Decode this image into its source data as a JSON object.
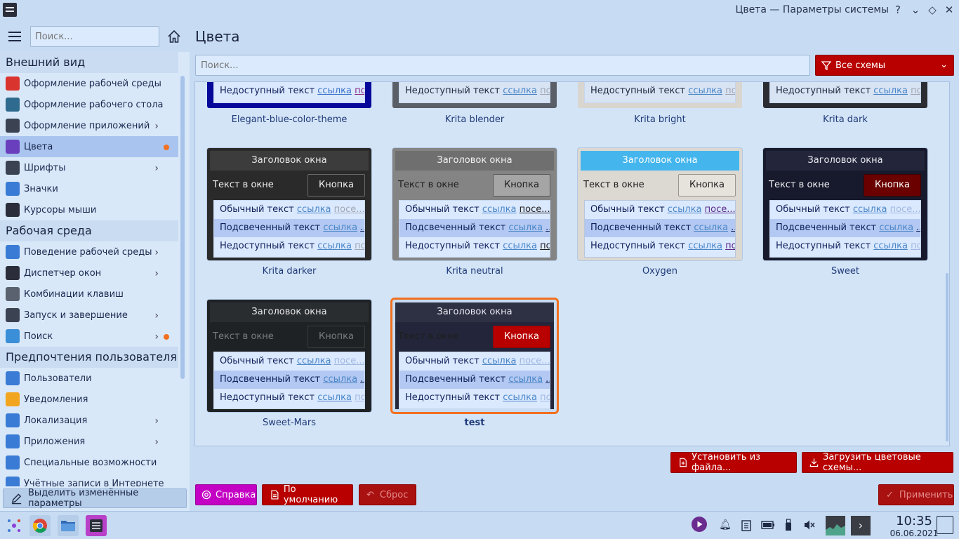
{
  "window": {
    "title": "Цвета — Параметры системы",
    "help_glyph": "?",
    "min_glyph": "⌄",
    "max_glyph": "◇",
    "close_glyph": "✕"
  },
  "sidebar": {
    "search_placeholder": "Поиск...",
    "sections": [
      {
        "title": "Внешний вид",
        "items": [
          {
            "label": "Оформление рабочей среды",
            "icon": "workspace-theme-icon",
            "color": "#d9352e"
          },
          {
            "label": "Оформление рабочего стола",
            "icon": "plasma-theme-icon",
            "color": "#2f6a8f"
          },
          {
            "label": "Оформление приложений",
            "icon": "app-style-icon",
            "color": "#3b4252",
            "chevron": true
          },
          {
            "label": "Цвета",
            "icon": "colors-icon",
            "color": "#6a3fbd",
            "active": true,
            "dot": true
          },
          {
            "label": "Шрифты",
            "icon": "fonts-icon",
            "color": "#3b4252",
            "chevron": true
          },
          {
            "label": "Значки",
            "icon": "icons-icon",
            "color": "#3a7bd5"
          },
          {
            "label": "Курсоры мыши",
            "icon": "cursor-icon",
            "color": "#2b2e3a"
          }
        ]
      },
      {
        "title": "Рабочая среда",
        "items": [
          {
            "label": "Поведение рабочей среды",
            "icon": "desktop-behavior-icon",
            "color": "#3a7bd5",
            "chevron": true
          },
          {
            "label": "Диспетчер окон",
            "icon": "window-manager-icon",
            "color": "#2b2e3a",
            "chevron": true
          },
          {
            "label": "Комбинации клавиш",
            "icon": "keyboard-icon",
            "color": "#5a6270"
          },
          {
            "label": "Запуск и завершение",
            "icon": "startup-icon",
            "color": "#3b4252",
            "chevron": true
          },
          {
            "label": "Поиск",
            "icon": "search-icon",
            "color": "#3a8fd8",
            "chevron": true,
            "dot": true
          }
        ]
      },
      {
        "title": "Предпочтения пользователя",
        "items": [
          {
            "label": "Пользователи",
            "icon": "users-icon",
            "color": "#3a7bd5"
          },
          {
            "label": "Уведомления",
            "icon": "bell-icon",
            "color": "#f2a61f"
          },
          {
            "label": "Локализация",
            "icon": "locale-icon",
            "color": "#3a7bd5",
            "chevron": true
          },
          {
            "label": "Приложения",
            "icon": "apps-icon",
            "color": "#3a7bd5",
            "chevron": true
          },
          {
            "label": "Специальные возможности",
            "icon": "accessibility-icon",
            "color": "#3a7bd5"
          },
          {
            "label": "Учётные записи в Интернете",
            "icon": "online-accounts-icon",
            "color": "#3a7bd5"
          }
        ]
      }
    ],
    "highlight_button": "Выделить изменённые параметры"
  },
  "main": {
    "title": "Цвета",
    "search_placeholder": "Поиск...",
    "filter_label": "Все схемы",
    "preview_strings": {
      "window_title": "Заголовок окна",
      "window_text": "Текст в окне",
      "button": "Кнопка",
      "normal": "Обычный текст",
      "selected": "Подсвеченный текст",
      "disabled": "Недоступный текст",
      "link": "ссылка",
      "visited_normal": "посе...",
      "visited_short": "по...",
      "visited_dots": "..."
    },
    "top_row": [
      {
        "name": "Elegant-blue-color-theme",
        "frame": "#06089a",
        "view_bg": "#dbe9ff",
        "text": "#10205a",
        "link": "#3b72c8",
        "visited": "#8a2b8a",
        "visited_text": "по"
      },
      {
        "name": "Krita blender",
        "frame": "#5a5e66",
        "view_bg": "#d8e4f4",
        "text": "#202a40",
        "link": "#4a86c8",
        "visited": "#a0a6b3",
        "visited_text": "по..."
      },
      {
        "name": "Krita bright",
        "frame": "#d9d5cf",
        "view_bg": "#d8e4f4",
        "text": "#202a40",
        "link": "#4a86c8",
        "visited": "#a0a6b3",
        "visited_text": "по..."
      },
      {
        "name": "Krita dark",
        "frame": "#2b2d33",
        "view_bg": "#d8e4f4",
        "text": "#202a40",
        "link": "#4a86c8",
        "visited": "#a0a6b3",
        "visited_text": "по..."
      }
    ],
    "themes": [
      {
        "name": "Krita darker",
        "frame": "#2a2a2a",
        "title_bg": "#3c3c3c",
        "title_fg": "#e8e8e8",
        "win_text": "#f0f0f0",
        "btn_bg": "#2a2a2a",
        "btn_fg": "#f0f0f0",
        "btn_border": "#6a6a6a",
        "view_bg": "#dbe9ff",
        "view_border": "#c6d6ee",
        "sel_bg": "#b3c8f2",
        "text": "#10205a",
        "link": "#4a86c8",
        "visited": "#a0a6b3",
        "row3_visited": "по...",
        "row1_visited": "посе...",
        "selected": false
      },
      {
        "name": "Krita neutral",
        "frame": "#848484",
        "title_bg": "#6f6f6f",
        "title_fg": "#f2f2f2",
        "win_text": "#202020",
        "btn_bg": "#a5a5a5",
        "btn_fg": "#202020",
        "btn_border": "#5a5a5a",
        "view_bg": "#dbe9ff",
        "view_border": "#c6d6ee",
        "sel_bg": "#b3c8f2",
        "text": "#10205a",
        "link": "#4a86c8",
        "visited": "#202020",
        "row3_visited": "по...",
        "row1_visited": "посе...",
        "selected": false
      },
      {
        "name": "Oxygen",
        "frame": "#dcd8d2",
        "title_bg": "#45b6ed",
        "title_fg": "#ffffff",
        "win_text": "#202020",
        "btn_bg": "#e6e2dc",
        "btn_fg": "#202020",
        "btn_border": "#9a958e",
        "view_bg": "#dbe9ff",
        "view_border": "#b7c6dc",
        "sel_bg": "#b3c8f2",
        "text": "#10205a",
        "link": "#4a86c8",
        "visited": "#5a2a8a",
        "row3_visited": "по...",
        "row1_visited": "посе...",
        "selected": false
      },
      {
        "name": "Sweet",
        "frame": "#171a2c",
        "title_bg": "#23263a",
        "title_fg": "#e8e8f0",
        "win_text": "#f0f0f5",
        "btn_bg": "#6a0000",
        "btn_fg": "#ffffff",
        "btn_border": "#3a0000",
        "view_bg": "#dbe9ff",
        "view_border": "#c6d6ee",
        "sel_bg": "#b3c8f2",
        "text": "#10205a",
        "link": "#4a86c8",
        "visited": "#a0b8e0",
        "row3_visited": "по...",
        "row1_visited": "посе...",
        "selected": false
      },
      {
        "name": "Sweet-Mars",
        "frame": "#1f2224",
        "title_bg": "#2a2d30",
        "title_fg": "#e8e8e8",
        "win_text": "#7a7d80",
        "btn_bg": "#1f2224",
        "btn_fg": "#7a7d80",
        "btn_border": "#3a3d40",
        "view_bg": "#dbe9ff",
        "view_border": "#c6d6ee",
        "sel_bg": "#b3c8f2",
        "text": "#10205a",
        "link": "#4a86c8",
        "visited": "#a0b8e0",
        "row3_visited": "по...",
        "row1_visited": "посе...",
        "selected": false
      },
      {
        "name": "test",
        "frame": "#23263a",
        "title_bg": "#2e3144",
        "title_fg": "#e8e8f0",
        "win_text": "#1e1e1e",
        "btn_bg": "#b80000",
        "btn_fg": "#ffffff",
        "btn_border": "#8d0000",
        "view_bg": "#dbe9ff",
        "view_border": "#c6d6ee",
        "sel_bg": "#b3c8f2",
        "text": "#10205a",
        "link": "#4a86c8",
        "visited": "#a0b8e0",
        "row3_visited": "по...",
        "row1_visited": "посе...",
        "selected": true,
        "card_bg": "#c7dbf2"
      }
    ],
    "install_button": "Установить из файла...",
    "download_button": "Загрузить цветовые схемы...",
    "help_button": "Справка",
    "defaults_button": "По умолчанию",
    "reset_button": "Сброс",
    "apply_button": "Применить"
  },
  "taskbar": {
    "time": "10:35",
    "date": "06.06.2021"
  }
}
